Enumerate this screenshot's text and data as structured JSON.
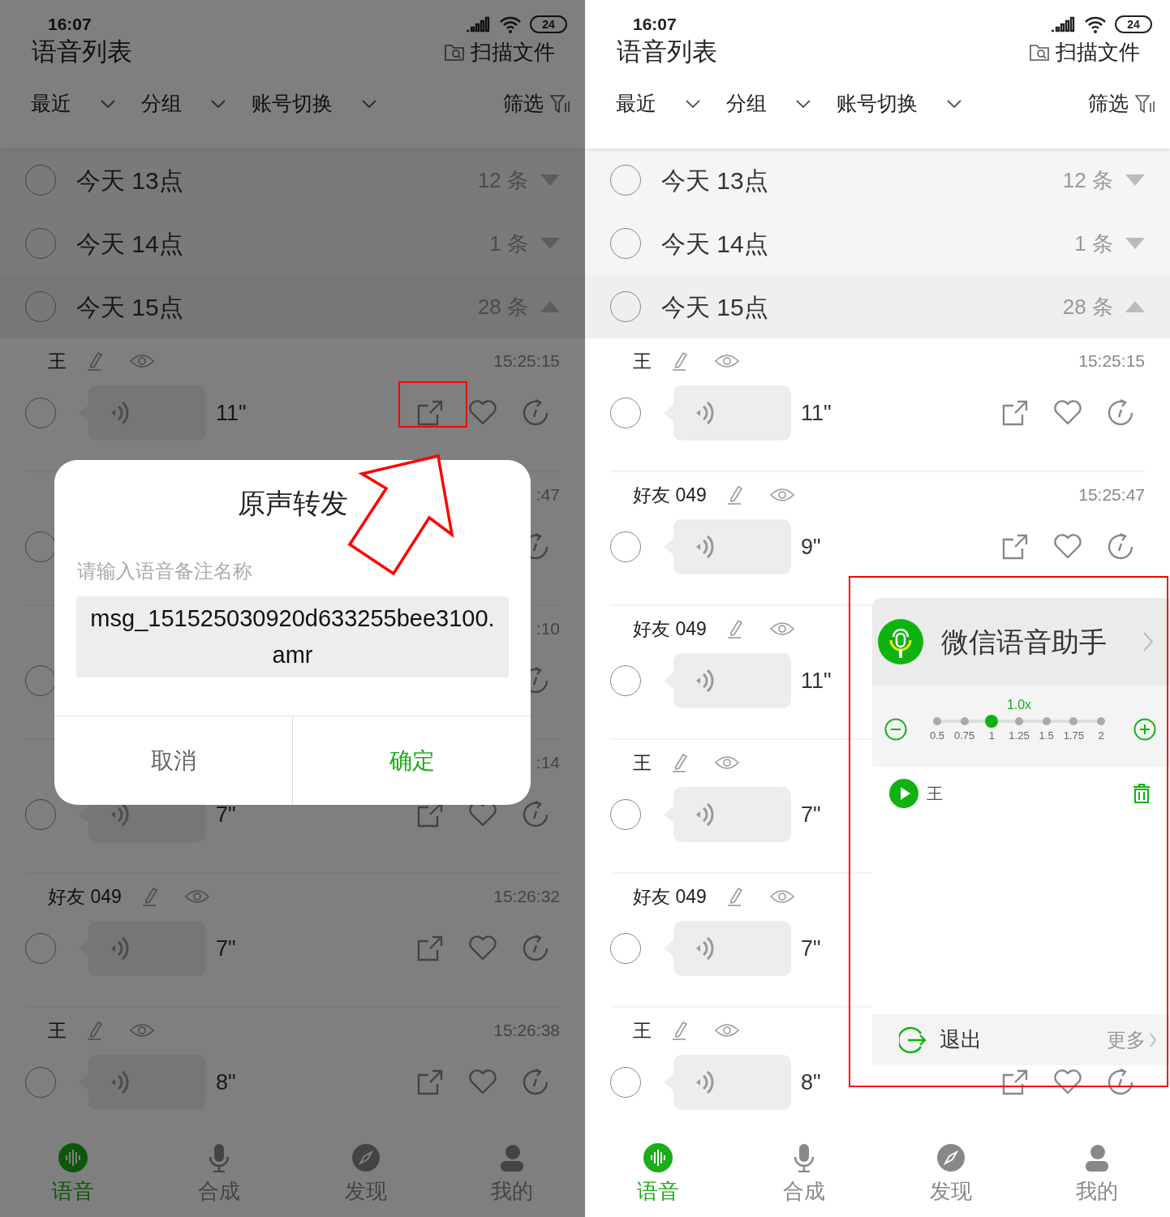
{
  "screens": [
    {
      "dimmed": true,
      "status_bar": {
        "time": "16:07",
        "battery": "24"
      },
      "title": "语音列表",
      "scan_label": "扫描文件",
      "filters": [
        {
          "label": "最近"
        },
        {
          "label": "分组"
        },
        {
          "label": "账号切换"
        }
      ],
      "filter_button": "筛选",
      "groups": [
        {
          "label": "今天 13点",
          "count": "12 条",
          "expanded": false,
          "checked": false
        },
        {
          "label": "今天 14点",
          "count": "1 条",
          "expanded": false,
          "checked": false
        },
        {
          "label": "今天 15点",
          "count": "28 条",
          "expanded": true,
          "checked": false
        }
      ],
      "items": [
        {
          "kind": "full",
          "name": "王",
          "time": "15:25:15",
          "duration": "11\"",
          "checked": false
        },
        {
          "kind": "replay",
          "time": ":47",
          "checked": false
        },
        {
          "kind": "replay",
          "time": ":10",
          "checked": false
        },
        {
          "kind": "full",
          "time": ":14",
          "duration": "7\"",
          "checked": false
        },
        {
          "kind": "full",
          "name": "好友 049",
          "time": "15:26:32",
          "duration": "7\"",
          "checked": false
        },
        {
          "kind": "full",
          "name": "王",
          "time": "15:26:38",
          "duration": "8\"",
          "checked": false
        }
      ],
      "tabs": [
        {
          "label": "语音",
          "selected": true
        },
        {
          "label": "合成",
          "selected": false
        },
        {
          "label": "发现",
          "selected": false
        },
        {
          "label": "我的",
          "selected": false
        }
      ],
      "dialog": {
        "title": "原声转发",
        "label": "请输入语音备注名称",
        "value": "msg_151525030920d633255bee3100.amr",
        "buttons": [
          {
            "label": "取消",
            "kind": "cancel"
          },
          {
            "label": "确定",
            "kind": "confirm"
          }
        ]
      },
      "annotations": [
        {
          "kind": "box"
        },
        {
          "kind": "arrow"
        }
      ]
    },
    {
      "dimmed": false,
      "status_bar": {
        "time": "16:07",
        "battery": "24"
      },
      "title": "语音列表",
      "scan_label": "扫描文件",
      "filters": [
        {
          "label": "最近"
        },
        {
          "label": "分组"
        },
        {
          "label": "账号切换"
        }
      ],
      "filter_button": "筛选",
      "groups": [
        {
          "label": "今天 13点",
          "count": "12 条",
          "expanded": false,
          "checked": false
        },
        {
          "label": "今天 14点",
          "count": "1 条",
          "expanded": false,
          "checked": false
        },
        {
          "label": "今天 15点",
          "count": "28 条",
          "expanded": true,
          "checked": false
        }
      ],
      "items": [
        {
          "kind": "full",
          "name": "王",
          "time": "15:25:15",
          "duration": "11\"",
          "checked": false
        },
        {
          "kind": "full",
          "name": "好友 049",
          "time": "15:25:47",
          "duration": "9\"",
          "checked": false
        },
        {
          "kind": "bare",
          "name": "好友 049",
          "duration": "11\"",
          "checked": false
        },
        {
          "kind": "bare",
          "name": "王",
          "duration": "7\"",
          "checked": false
        },
        {
          "kind": "bare",
          "name": "好友 049",
          "duration": "7\"",
          "checked": false
        },
        {
          "kind": "full",
          "name": "王",
          "duration": "8\"",
          "checked": false
        }
      ],
      "tabs": [
        {
          "label": "语音",
          "selected": true
        },
        {
          "label": "合成",
          "selected": false
        },
        {
          "label": "发现",
          "selected": false
        },
        {
          "label": "我的",
          "selected": false
        }
      ],
      "assistant_panel": {
        "title": "微信语音助手",
        "speed": {
          "reading": "1.0x",
          "ticks": [
            {
              "label": "0.5",
              "selected": false
            },
            {
              "label": "0.75",
              "selected": false
            },
            {
              "label": "1",
              "selected": true
            },
            {
              "label": "1.25",
              "selected": false
            },
            {
              "label": "1.5",
              "selected": false
            },
            {
              "label": "1.75",
              "selected": false
            },
            {
              "label": "2",
              "selected": false
            }
          ]
        },
        "playlist": [
          {
            "name": "王"
          }
        ],
        "exit_label": "退出",
        "more_label": "更多"
      },
      "annotations": [
        {
          "kind": "box"
        }
      ]
    }
  ]
}
